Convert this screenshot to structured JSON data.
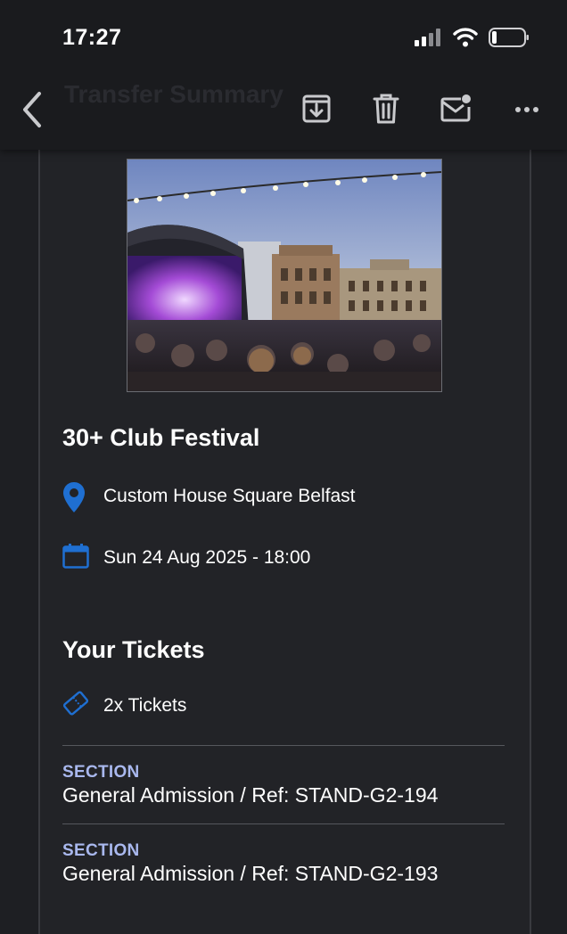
{
  "status_bar": {
    "time": "17:27"
  },
  "toolbar": {
    "title": "Transfer Summary"
  },
  "event": {
    "title": "30+ Club Festival",
    "venue": "Custom House Square Belfast",
    "date": "Sun 24 Aug 2025 - 18:00"
  },
  "tickets": {
    "heading": "Your Tickets",
    "count": "2x Tickets",
    "sections": [
      {
        "label": "SECTION",
        "value": "General Admission / Ref: STAND-G2-194"
      },
      {
        "label": "SECTION",
        "value": "General Admission / Ref: STAND-G2-193"
      }
    ]
  },
  "colors": {
    "background": "#1e1f23",
    "accent_blue": "#1f6fd1",
    "section_label": "#a9b8ee"
  }
}
